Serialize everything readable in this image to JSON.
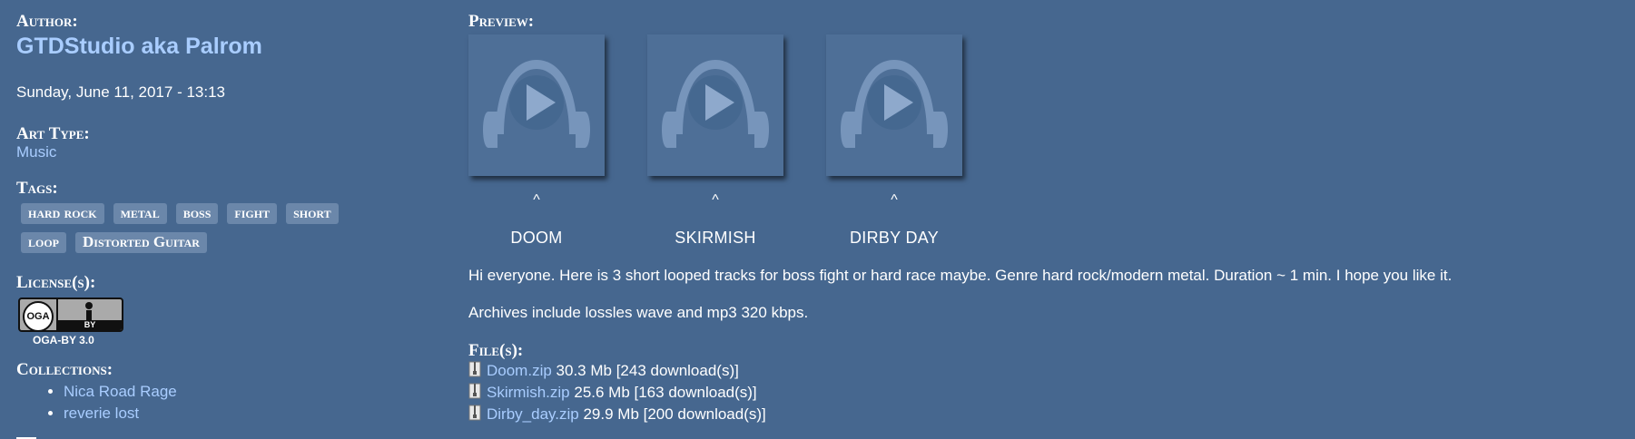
{
  "author": {
    "heading": "Author:",
    "name": "GTDStudio aka Palrom"
  },
  "post_date": "Sunday, June 11, 2017 - 13:13",
  "art_type": {
    "heading": "Art Type:",
    "value": "Music"
  },
  "tags": {
    "heading": "Tags:",
    "items": [
      "hard rock",
      "metal",
      "boss",
      "fight",
      "short",
      "loop",
      "Distorted Guitar"
    ]
  },
  "license": {
    "heading": "License(s):",
    "badge_left": "OGA",
    "badge_right": "BY",
    "label": "OGA-BY 3.0"
  },
  "collections": {
    "heading": "Collections:",
    "items": [
      "Nica Road Rage",
      "reverie lost"
    ]
  },
  "preview": {
    "heading": "Preview:",
    "items": [
      {
        "caret": "^",
        "title": "DOOM"
      },
      {
        "caret": "^",
        "title": "SKIRMISH"
      },
      {
        "caret": "^",
        "title": "DIRBY DAY"
      }
    ]
  },
  "description": [
    "Hi everyone. Here is 3 short looped tracks for boss fight or hard race maybe. Genre hard rock/modern metal. Duration ~ 1 min. I hope you like it.",
    "Archives include lossles wave and mp3 320 kbps."
  ],
  "files": {
    "heading": "File(s):",
    "items": [
      {
        "name": "Doom.zip",
        "info": "30.3 Mb [243 download(s)]"
      },
      {
        "name": "Skirmish.zip",
        "info": "25.6 Mb [163 download(s)]"
      },
      {
        "name": "Dirby_day.zip",
        "info": "29.9 Mb [200 download(s)]"
      }
    ]
  },
  "colors": {
    "background": "#46678f",
    "link": "#a9cdff",
    "tag_bg": "#6b87aa"
  },
  "icons": {
    "preview_play": "headphones-play-icon",
    "file": "zip-file-icon"
  }
}
